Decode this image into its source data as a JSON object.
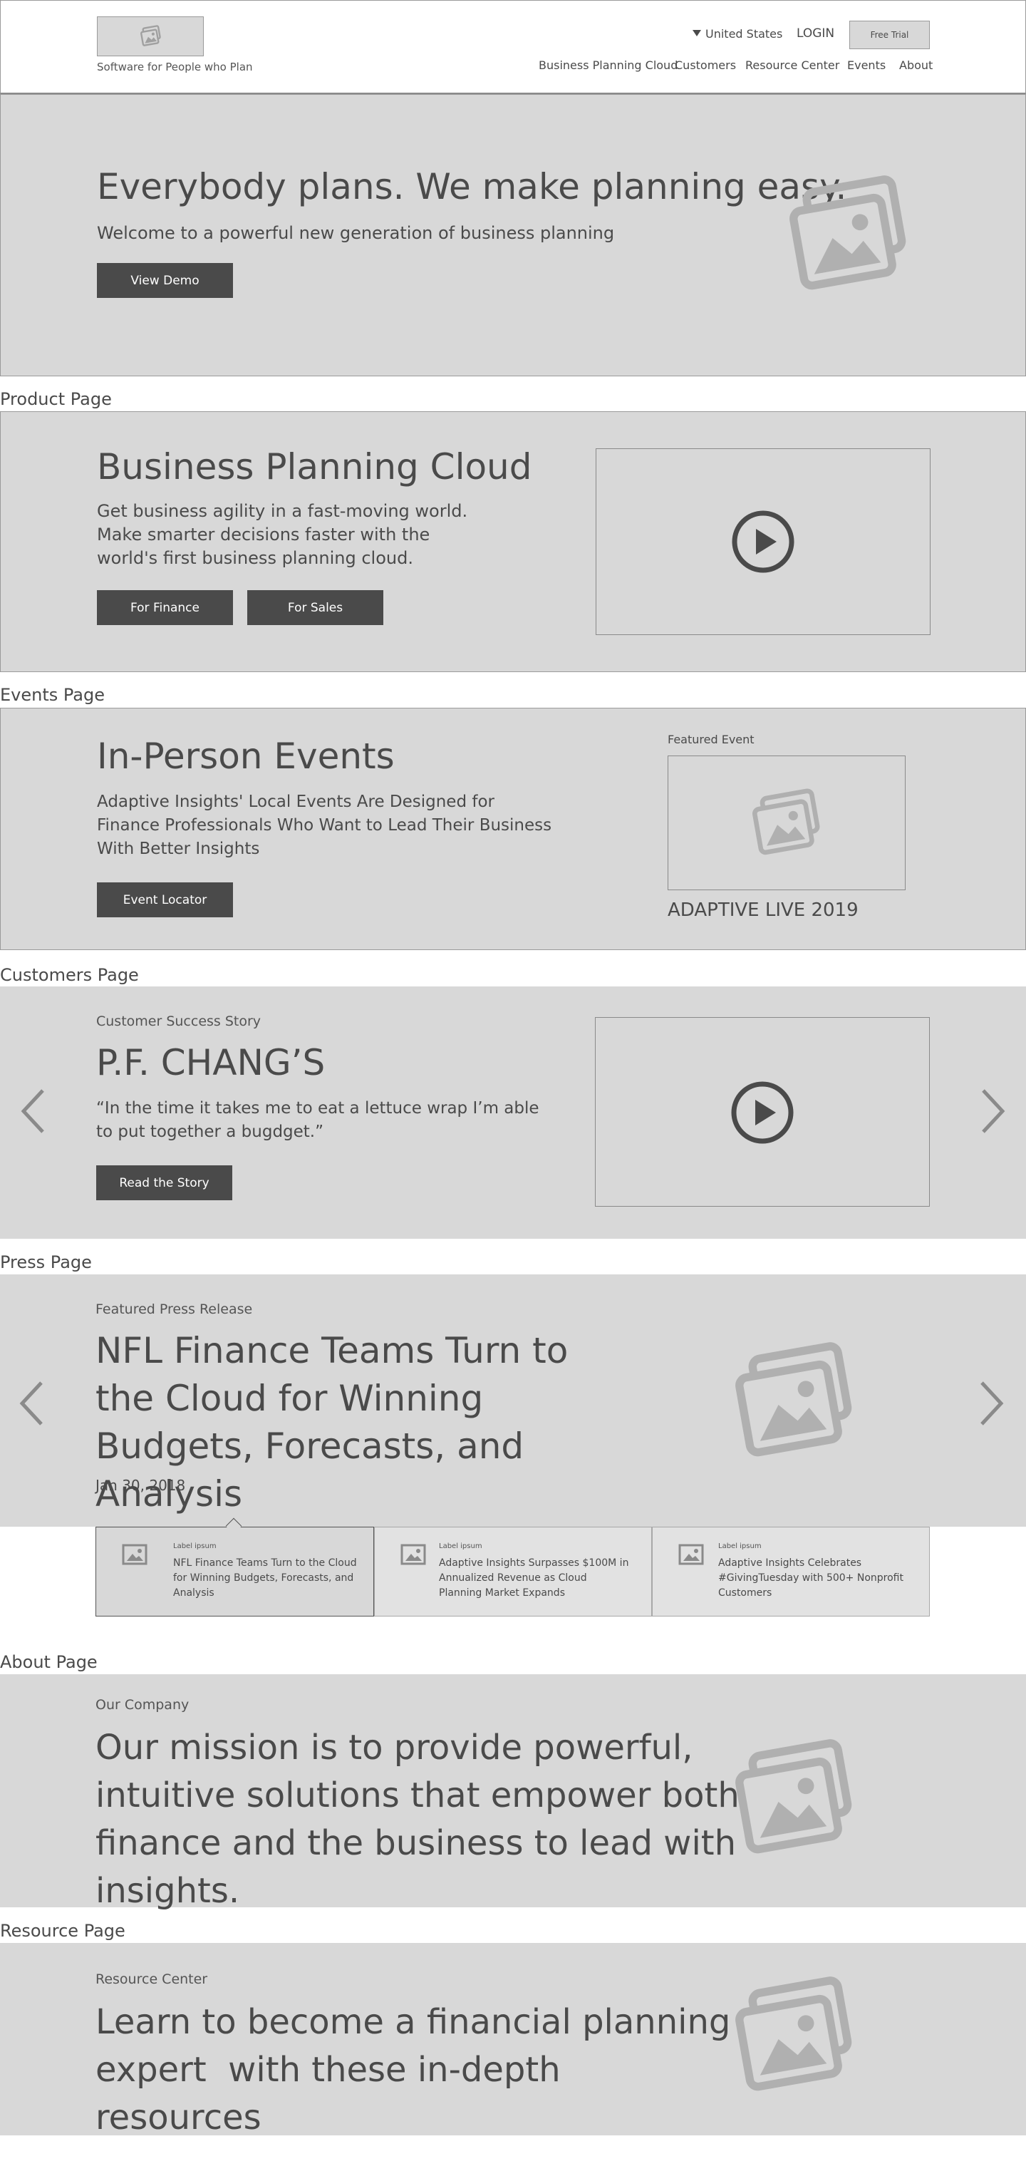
{
  "header": {
    "tagline": "Software for People who Plan",
    "country": "United States",
    "login": "LOGIN",
    "free_trial": "Free Trial",
    "nav": [
      "Business Planning Cloud",
      "Customers",
      "Resource Center",
      "Events",
      "About"
    ]
  },
  "hero": {
    "title": "Everybody plans. We make planning easy.",
    "subtitle": "Welcome to a powerful new generation of business planning",
    "button": "View Demo"
  },
  "product": {
    "section_label": "Product Page",
    "title": "Business Planning Cloud",
    "body": "Get business agility in a fast-moving world. Make smarter decisions faster with the world's first business planning cloud.",
    "button_finance": "For Finance",
    "button_sales": "For Sales"
  },
  "events": {
    "section_label": "Events Page",
    "title": "In-Person Events",
    "body": "Adaptive Insights' Local Events Are Designed for Finance Professionals Who Want to Lead Their Business With Better Insights",
    "button": "Event Locator",
    "featured_label": "Featured Event",
    "featured_name": "ADAPTIVE LIVE 2019"
  },
  "customers": {
    "section_label": "Customers Page",
    "eyebrow": "Customer Success Story",
    "title": "P.F. CHANG’S",
    "quote": "“In the time it takes me to eat a lettuce wrap I’m able to put together a bugdget.”",
    "button": "Read the Story"
  },
  "press": {
    "section_label": "Press Page",
    "eyebrow": "Featured Press Release",
    "title": "NFL Finance Teams Turn to the Cloud for Winning Budgets, Forecasts, and Analysis",
    "date": "Jan 30, 2018",
    "tiles": [
      {
        "label": "Label ipsum",
        "text": "NFL Finance Teams Turn to the Cloud for Winning Budgets, Forecasts, and Analysis"
      },
      {
        "label": "Label ipsum",
        "text": "Adaptive Insights Surpasses $100M in Annualized Revenue as Cloud Planning Market Expands"
      },
      {
        "label": "Label ipsum",
        "text": "Adaptive Insights Celebrates #GivingTuesday with 500+ Nonprofit Customers"
      }
    ]
  },
  "about": {
    "section_label": "About Page",
    "eyebrow": "Our Company",
    "title": "Our mission is to provide powerful, intuitive solutions that empower both finance and the business to lead with insights."
  },
  "resource": {
    "section_label": "Resource Page",
    "eyebrow": "Resource Center",
    "title": "Learn to become a financial planning expert  with these in-depth resources"
  },
  "icons": {
    "image": "image-placeholder-icon",
    "play": "play-icon",
    "chevron_left": "chevron-left-icon",
    "chevron_right": "chevron-right-icon",
    "caret_down": "caret-down-icon"
  },
  "colors": {
    "panel": "#d8d8d8",
    "button": "#4a4a4a",
    "text": "#4a4a4a",
    "icon": "#b0b0b0"
  }
}
